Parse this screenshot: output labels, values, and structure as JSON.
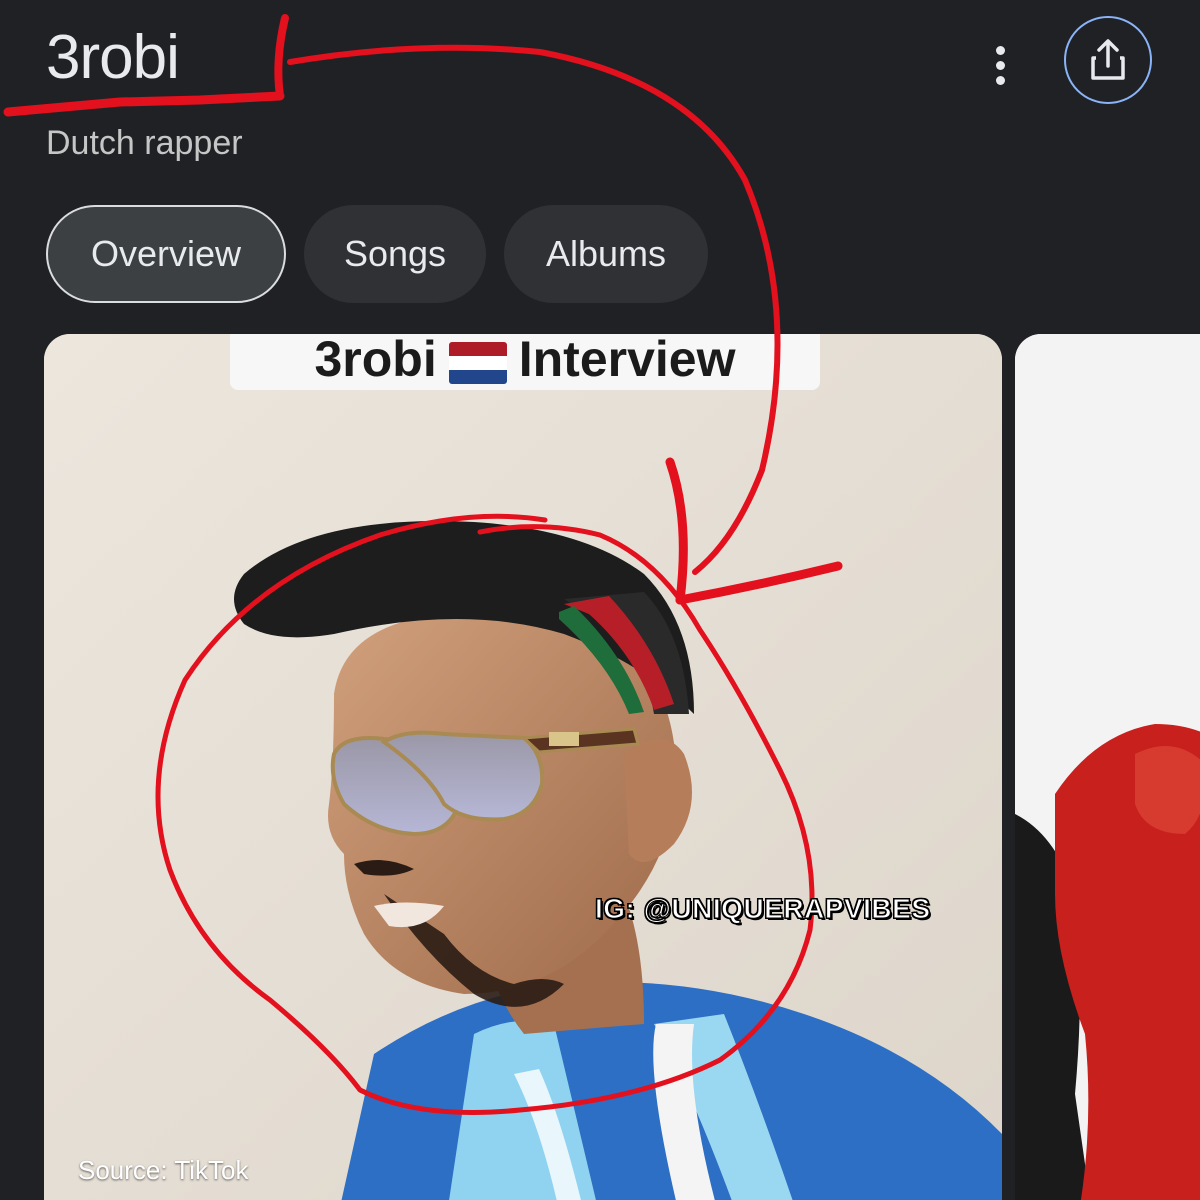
{
  "header": {
    "title": "3robi",
    "subtitle": "Dutch rapper",
    "more_icon": "more-vert-icon",
    "share_icon": "share-icon"
  },
  "tabs": [
    {
      "label": "Overview",
      "active": true
    },
    {
      "label": "Songs",
      "active": false
    },
    {
      "label": "Albums",
      "active": false
    }
  ],
  "image_card": {
    "caption": "3robi",
    "caption_suffix": "Interview",
    "source": "Source: TikTok",
    "watermark": "IG: @UNIQUERAPVIBES"
  },
  "colors": {
    "background": "#202125",
    "chip": "#303134",
    "share_ring": "#8ab4f8",
    "annotation_red": "#e3101e"
  }
}
